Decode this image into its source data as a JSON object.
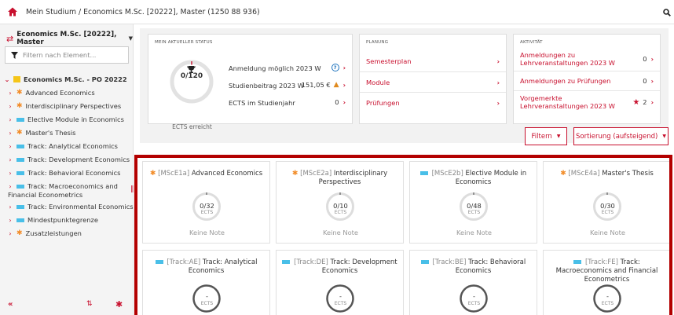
{
  "topbar": {
    "breadcrumb": "Mein Studium / Economics M.Sc. [20222], Master (1250 88 936)"
  },
  "sidebar": {
    "program": "Economics M.Sc. [20222], Master",
    "filter_placeholder": "Filtern nach Element...",
    "tree": [
      {
        "label": "Economics M.Sc. - PO 20222",
        "marker": "folder",
        "expanded": true
      },
      {
        "label": "Advanced Economics",
        "marker": "star"
      },
      {
        "label": "Interdisciplinary Perspectives",
        "marker": "star"
      },
      {
        "label": "Elective Module in Economics",
        "marker": "bar"
      },
      {
        "label": "Master's Thesis",
        "marker": "star"
      },
      {
        "label": "Track: Analytical Economics",
        "marker": "bar"
      },
      {
        "label": "Track: Development Economics",
        "marker": "bar"
      },
      {
        "label": "Track: Behavioral Economics",
        "marker": "bar"
      },
      {
        "label": "Track: Macroeconomics and",
        "label2": "Financial Econometrics",
        "marker": "bar"
      },
      {
        "label": "Track: Environmental Economics",
        "marker": "bar"
      },
      {
        "label": "Mindestpunktegrenze",
        "marker": "bar"
      },
      {
        "label": "Zusatzleistungen",
        "marker": "star"
      }
    ]
  },
  "status": {
    "header": "MEIN AKTUELLER STATUS",
    "ects_value": "0/120",
    "ects_caption": "ECTS erreicht",
    "rows": [
      {
        "label": "Anmeldung möglich 2023 W",
        "icon": "help-icon"
      },
      {
        "label": "Studienbeitrag 2023 W",
        "value": "151,05 €",
        "icon": "warning-icon"
      },
      {
        "label": "ECTS im Studienjahr",
        "value": "0"
      }
    ]
  },
  "planning": {
    "header": "PLANUNG",
    "links": [
      "Semesterplan",
      "Module",
      "Prüfungen"
    ]
  },
  "activity": {
    "header": "AKTIVITÄT",
    "items": [
      {
        "label": "Anmeldungen zu Lehrveranstaltungen 2023 W",
        "count": "0"
      },
      {
        "label": "Anmeldungen zu Prüfungen",
        "count": "0"
      },
      {
        "label": "Vorgemerkte Lehrveranstaltungen 2023 W",
        "count": "2",
        "icon": "star-icon"
      }
    ]
  },
  "toolbar": {
    "filter_label": "Filtern",
    "sort_label": "Sortierung (aufsteigend)"
  },
  "modules": [
    {
      "code": "[MScE1a]",
      "name": "Advanced Economics",
      "marker": "star",
      "value": "0/32",
      "unit": "ECTS",
      "note": "Keine Note"
    },
    {
      "code": "[MScE2a]",
      "name": "Interdisciplinary Perspectives",
      "marker": "star",
      "value": "0/10",
      "unit": "ECTS",
      "note": "Keine Note"
    },
    {
      "code": "[MScE2b]",
      "name": "Elective Module in Economics",
      "marker": "bar",
      "value": "0/48",
      "unit": "ECTS",
      "note": "Keine Note"
    },
    {
      "code": "[MScE4a]",
      "name": "Master's Thesis",
      "marker": "star",
      "value": "0/30",
      "unit": "ECTS",
      "note": "Keine Note"
    },
    {
      "code": "[Track:AE]",
      "name": "Track: Analytical Economics",
      "marker": "bar",
      "value": "-",
      "unit": "ECTS"
    },
    {
      "code": "[Track:DE]",
      "name": "Track: Development Economics",
      "marker": "bar",
      "value": "-",
      "unit": "ECTS"
    },
    {
      "code": "[Track:BE]",
      "name": "Track: Behavioral Economics",
      "marker": "bar",
      "value": "-",
      "unit": "ECTS"
    },
    {
      "code": "[Track:FE]",
      "name": "Track: Macroeconomics and Financial Econometrics",
      "marker": "bar",
      "value": "-",
      "unit": "ECTS"
    }
  ],
  "colors": {
    "accent": "#c8102e",
    "star": "#f28c28",
    "bar": "#49bfe8",
    "folder": "#f5c518",
    "highlight_border": "#b30000"
  }
}
